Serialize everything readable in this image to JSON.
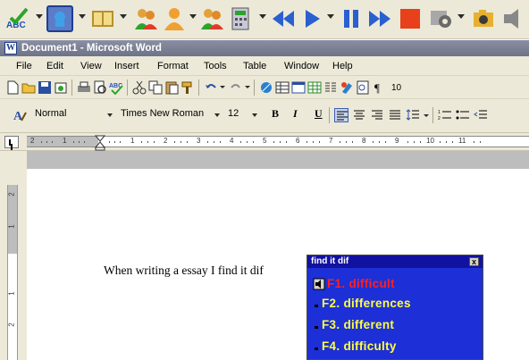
{
  "window": {
    "title": "Document1 - Microsoft Word",
    "app_icon": "W"
  },
  "menu": [
    {
      "label": "File"
    },
    {
      "label": "Edit"
    },
    {
      "label": "View"
    },
    {
      "label": "Insert"
    },
    {
      "label": "Format"
    },
    {
      "label": "Tools"
    },
    {
      "label": "Table"
    },
    {
      "label": "Window"
    },
    {
      "label": "Help"
    }
  ],
  "formatting": {
    "style": "Normal",
    "font": "Times New Roman",
    "size": "12",
    "bold": "B",
    "italic": "I",
    "underline": "U"
  },
  "standard_toolbar": {
    "zoom_partial": "10"
  },
  "ruler": {
    "labels": [
      "2",
      "1",
      "1",
      "2",
      "3",
      "4",
      "5",
      "6",
      "7",
      "8",
      "9",
      "10",
      "11"
    ]
  },
  "vertical_ruler": {
    "labels": [
      "2",
      "1",
      "1",
      "2"
    ]
  },
  "document": {
    "text": "When writing a essay I find it dif"
  },
  "prediction": {
    "title": "find it dif",
    "close_glyph": "x",
    "items": [
      {
        "label": "F1. difficult",
        "color": "#ff2020"
      },
      {
        "label": "F2. differences",
        "color": "#ffff40"
      },
      {
        "label": "F3. different",
        "color": "#ffff40"
      },
      {
        "label": "F4. difficulty",
        "color": "#ffff40"
      }
    ]
  },
  "colors": {
    "chrome": "#ece9d8",
    "popup_bg": "#1d2fd6",
    "highlight": "#ff2020"
  }
}
